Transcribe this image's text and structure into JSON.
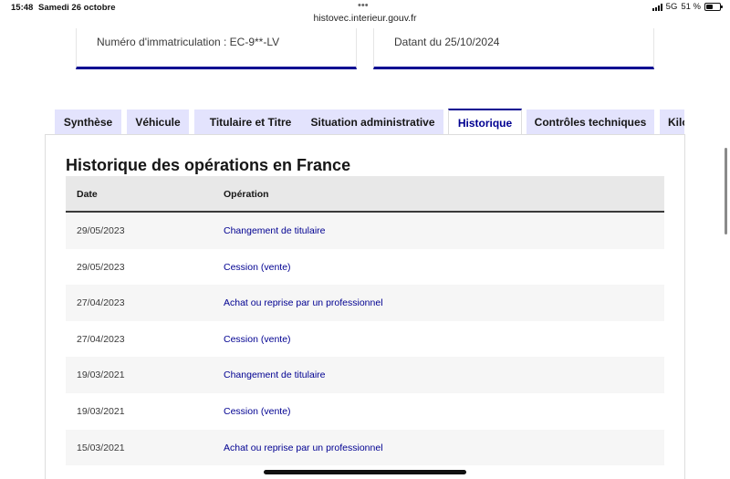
{
  "status_bar": {
    "time": "15:48",
    "date": "Samedi 26 octobre",
    "dots": "•••",
    "network": "5G",
    "battery": "51 %",
    "battery_level": 0.51
  },
  "browser": {
    "url": "histovec.interieur.gouv.fr"
  },
  "cards": {
    "registration": "Numéro d'immatriculation : EC-9**-LV",
    "date": "Datant du 25/10/2024"
  },
  "tabs": [
    {
      "label": "Synthèse"
    },
    {
      "label": "Véhicule"
    },
    {
      "label": "Titulaire et Titre"
    },
    {
      "label": "Situation administrative"
    },
    {
      "label": "Historique",
      "active": true
    },
    {
      "label": "Contrôles techniques"
    },
    {
      "label": "Kilo"
    }
  ],
  "history": {
    "title": "Historique des opérations en France",
    "columns": {
      "date": "Date",
      "operation": "Opération"
    },
    "rows": [
      {
        "date": "29/05/2023",
        "operation": "Changement de titulaire"
      },
      {
        "date": "29/05/2023",
        "operation": "Cession (vente)"
      },
      {
        "date": "27/04/2023",
        "operation": "Achat ou reprise par un professionnel"
      },
      {
        "date": "27/04/2023",
        "operation": "Cession (vente)"
      },
      {
        "date": "19/03/2021",
        "operation": "Changement de titulaire"
      },
      {
        "date": "19/03/2021",
        "operation": "Cession (vente)"
      },
      {
        "date": "15/03/2021",
        "operation": "Achat ou reprise par un professionnel"
      },
      {
        "date": "",
        "operation": ""
      }
    ]
  },
  "colors": {
    "accent": "#000091",
    "tab_bg": "#e3e3fd",
    "header_bg": "#e8e8e8",
    "row_alt_bg": "#f6f6f6"
  }
}
